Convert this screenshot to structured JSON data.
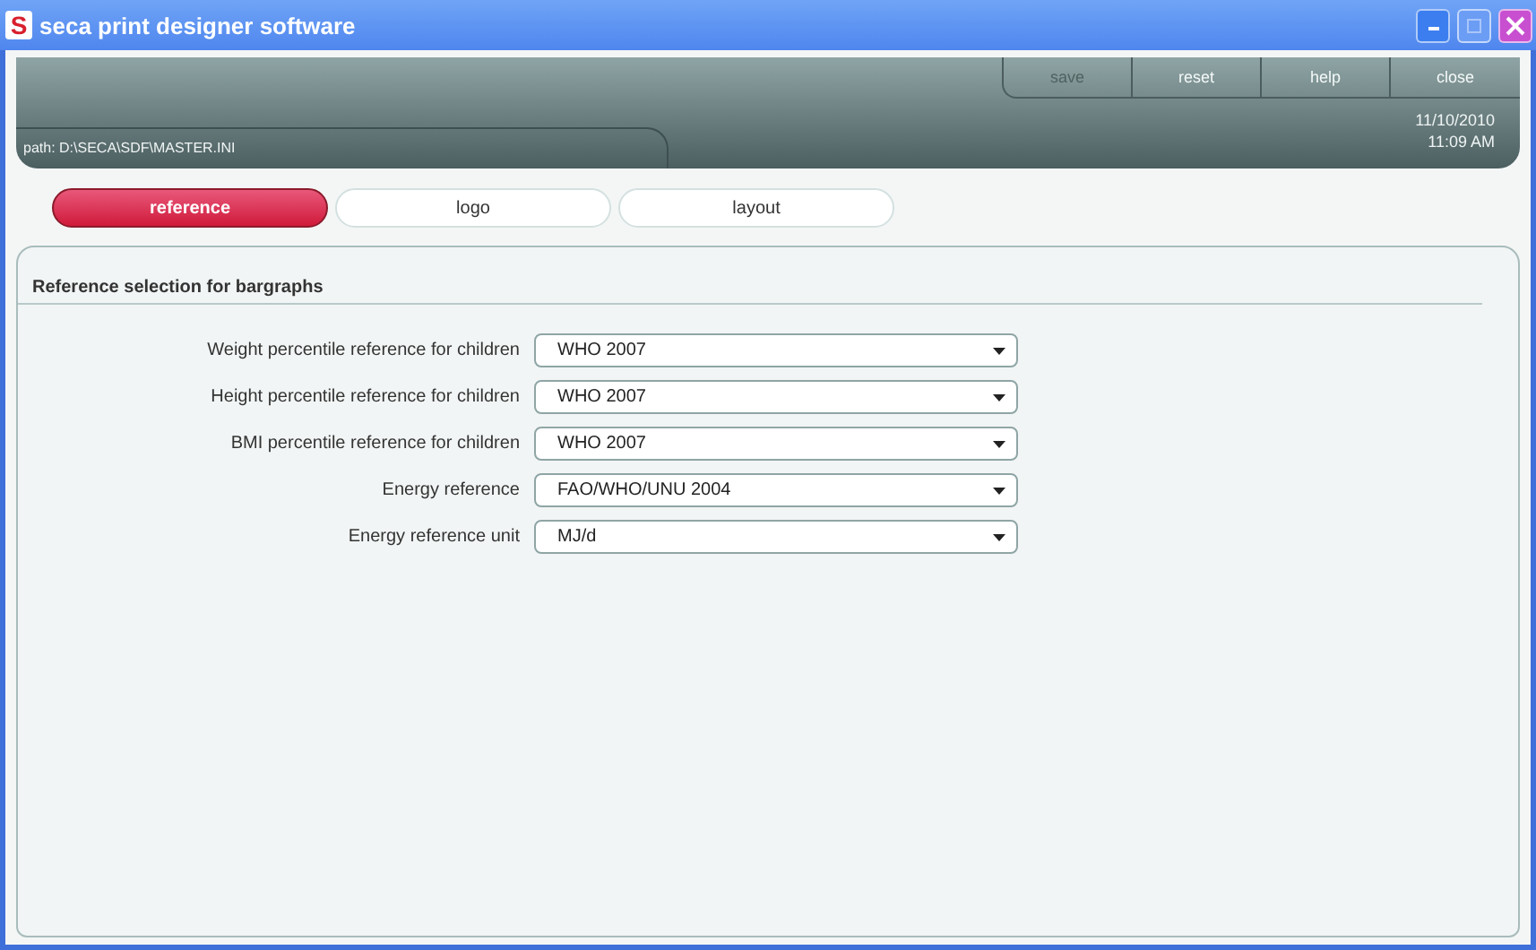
{
  "window": {
    "logo": "S",
    "title": "seca print designer software"
  },
  "header": {
    "path": "path:  D:\\SECA\\SDF\\MASTER.INI",
    "date": "11/10/2010",
    "time": "11:09 AM",
    "buttons": [
      {
        "label": "save",
        "disabled": true
      },
      {
        "label": "reset",
        "disabled": false
      },
      {
        "label": "help",
        "disabled": false
      },
      {
        "label": "close",
        "disabled": false
      }
    ]
  },
  "tabs": [
    {
      "label": "reference",
      "selected": true
    },
    {
      "label": "logo",
      "selected": false
    },
    {
      "label": "layout",
      "selected": false
    }
  ],
  "panel": {
    "title": "Reference selection for bargraphs",
    "fields": [
      {
        "label": "Weight percentile reference for children",
        "value": "WHO 2007"
      },
      {
        "label": "Height percentile reference for children",
        "value": "WHO 2007"
      },
      {
        "label": "BMI percentile reference for children",
        "value": "WHO 2007"
      },
      {
        "label": "Energy reference",
        "value": "FAO/WHO/UNU 2004"
      },
      {
        "label": "Energy reference unit",
        "value": "MJ/d"
      }
    ]
  }
}
